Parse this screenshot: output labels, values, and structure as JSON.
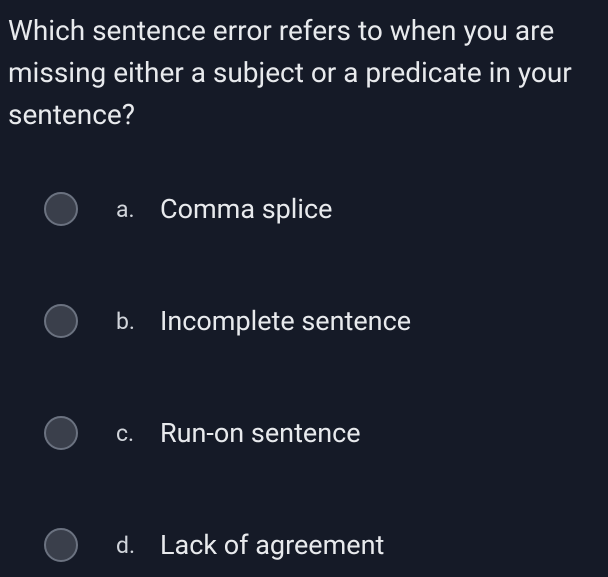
{
  "question": {
    "text": "Which sentence error refers to when you are missing either a subject or a predicate in your sentence?"
  },
  "options": [
    {
      "letter": "a.",
      "text": "Comma splice"
    },
    {
      "letter": "b.",
      "text": "Incomplete sentence"
    },
    {
      "letter": "c.",
      "text": "Run-on sentence"
    },
    {
      "letter": "d.",
      "text": "Lack of agreement"
    }
  ]
}
